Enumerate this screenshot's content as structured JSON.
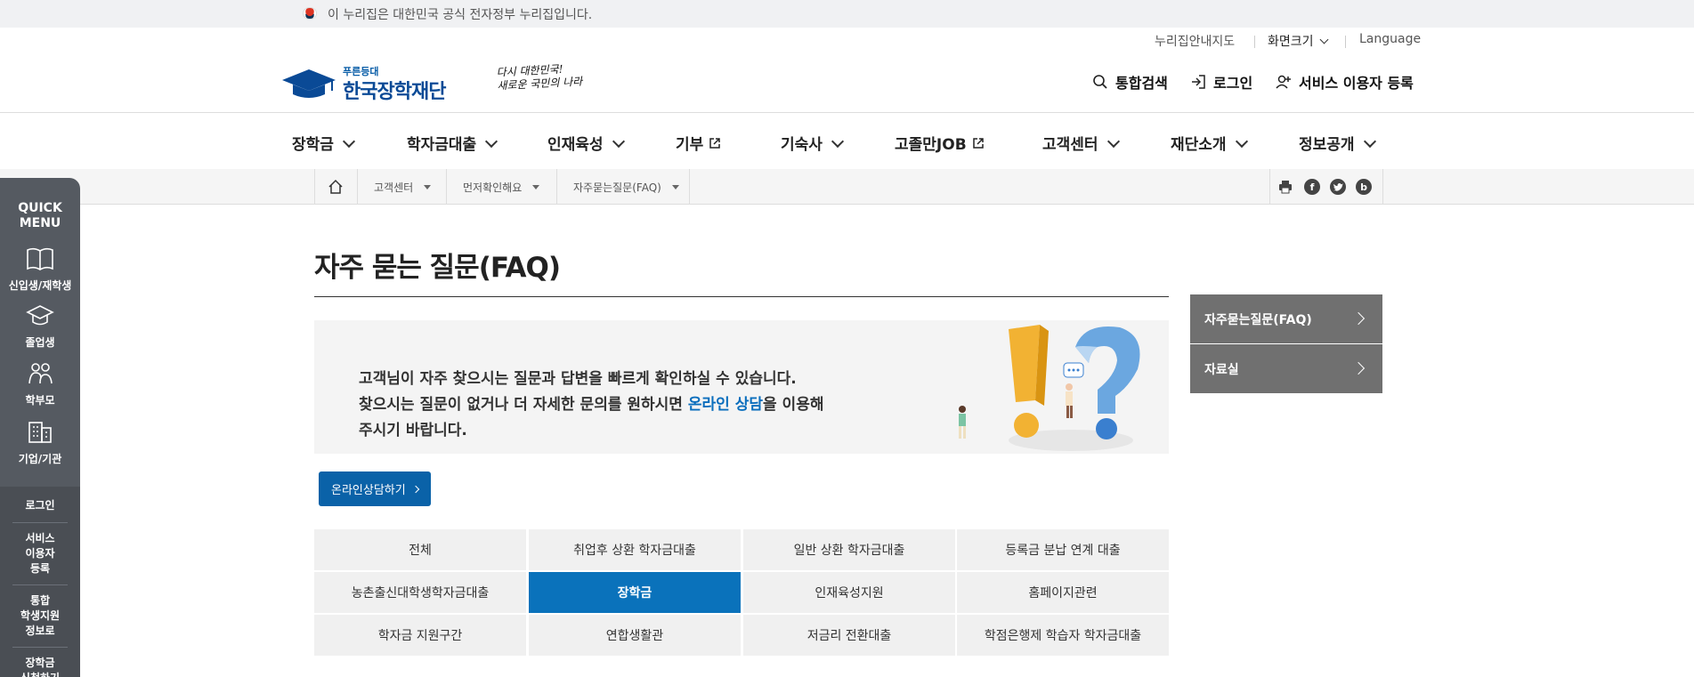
{
  "gov_banner": {
    "text": "이 누리집은 대한민국 공식 전자정부 누리집입니다."
  },
  "utility": {
    "sitemap": "누리집안내지도",
    "font_size": "화면크기",
    "language": "Language"
  },
  "logo": {
    "small": "푸른등대",
    "big": "한국장학재단"
  },
  "slogan": {
    "line1": "다시 대한민국!",
    "line2": "새로운 국민의 나라"
  },
  "header_actions": {
    "search": "통합검색",
    "login": "로그인",
    "register": "서비스 이용자 등록"
  },
  "gnb": [
    {
      "label": "장학금",
      "type": "menu"
    },
    {
      "label": "학자금대출",
      "type": "menu"
    },
    {
      "label": "인재육성",
      "type": "menu"
    },
    {
      "label": "기부",
      "type": "external"
    },
    {
      "label": "기숙사",
      "type": "menu"
    },
    {
      "label": "고졸만JOB",
      "type": "external"
    },
    {
      "label": "고객센터",
      "type": "menu"
    },
    {
      "label": "재단소개",
      "type": "menu"
    },
    {
      "label": "정보공개",
      "type": "menu"
    }
  ],
  "breadcrumb": {
    "level1": "고객센터",
    "level2": "먼저확인해요",
    "level3": "자주묻는질문(FAQ)"
  },
  "share_icons": [
    "print-icon",
    "facebook-icon",
    "twitter-icon",
    "blog-icon"
  ],
  "quick_menu": {
    "title_line1": "QUICK",
    "title_line2": "MENU",
    "items": [
      "신입생/재학생",
      "졸업생",
      "학부모",
      "기업/기관"
    ],
    "links": [
      "로그인",
      "서비스\n이용자\n등록",
      "통합\n학생지원\n정보로",
      "장학금\n신청하기"
    ]
  },
  "page_title": "자주 묻는 질문(FAQ)",
  "intro": {
    "line1": "고객님이 자주 찾으시는 질문과 답변을 빠르게 확인하실 수 있습니다.",
    "line2_pre": "찾으시는 질문이 없거나 더 자세한 문의를 원하시면 ",
    "line2_link": "온라인 상담",
    "line2_post": "을 이용해",
    "line3": "주시기 바랍니다."
  },
  "consult_button": "온라인상담하기",
  "categories": [
    {
      "label": "전체",
      "active": false
    },
    {
      "label": "취업후 상환 학자금대출",
      "active": false
    },
    {
      "label": "일반 상환 학자금대출",
      "active": false
    },
    {
      "label": "등록금 분납 연계 대출",
      "active": false
    },
    {
      "label": "농촌출신대학생학자금대출",
      "active": false
    },
    {
      "label": "장학금",
      "active": true
    },
    {
      "label": "인재육성지원",
      "active": false
    },
    {
      "label": "홈페이지관련",
      "active": false
    },
    {
      "label": "학자금 지원구간",
      "active": false
    },
    {
      "label": "연합생활관",
      "active": false
    },
    {
      "label": "저금리 전환대출",
      "active": false
    },
    {
      "label": "학점은행제 학습자 학자금대출",
      "active": false
    }
  ],
  "side_menu": [
    "자주묻는질문(FAQ)",
    "자료실"
  ],
  "colors": {
    "primary": "#0a62a8",
    "active_tab": "#0a72bb",
    "quick_bg": "#555a61",
    "side_bg": "#707070"
  }
}
